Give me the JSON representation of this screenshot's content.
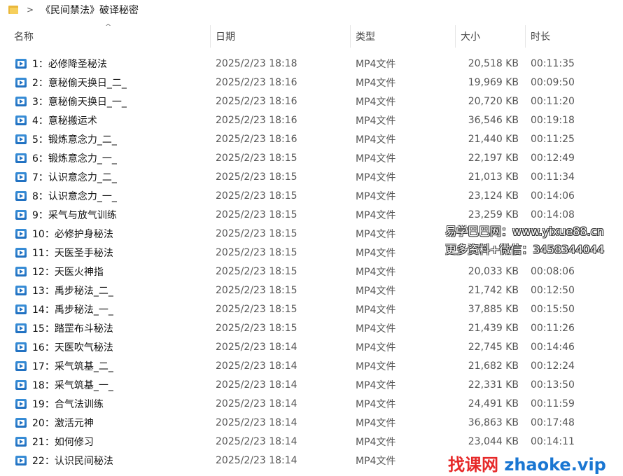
{
  "breadcrumb": {
    "separator": ">",
    "path": "《民间禁法》破译秘密"
  },
  "columns": {
    "name": "名称",
    "date": "日期",
    "type": "类型",
    "size": "大小",
    "duration": "时长",
    "sort_indicator": "^"
  },
  "files": [
    {
      "name": "1：必修降圣秘法",
      "date": "2025/2/23 18:18",
      "type": "MP4文件",
      "size": "20,518 KB",
      "duration": "00:11:35"
    },
    {
      "name": "2：意秘偷天换日_二_",
      "date": "2025/2/23 18:16",
      "type": "MP4文件",
      "size": "19,969 KB",
      "duration": "00:09:50"
    },
    {
      "name": "3：意秘偷天换日_一_",
      "date": "2025/2/23 18:16",
      "type": "MP4文件",
      "size": "20,720 KB",
      "duration": "00:11:20"
    },
    {
      "name": "4：意秘搬运术",
      "date": "2025/2/23 18:16",
      "type": "MP4文件",
      "size": "36,546 KB",
      "duration": "00:19:18"
    },
    {
      "name": "5：锻炼意念力_二_",
      "date": "2025/2/23 18:16",
      "type": "MP4文件",
      "size": "21,440 KB",
      "duration": "00:11:25"
    },
    {
      "name": "6：锻炼意念力_一_",
      "date": "2025/2/23 18:15",
      "type": "MP4文件",
      "size": "22,197 KB",
      "duration": "00:12:49"
    },
    {
      "name": "7：认识意念力_二_",
      "date": "2025/2/23 18:15",
      "type": "MP4文件",
      "size": "21,013 KB",
      "duration": "00:11:34"
    },
    {
      "name": "8：认识意念力_一_",
      "date": "2025/2/23 18:15",
      "type": "MP4文件",
      "size": "23,124 KB",
      "duration": "00:14:06"
    },
    {
      "name": "9：采气与放气训练",
      "date": "2025/2/23 18:15",
      "type": "MP4文件",
      "size": "23,259 KB",
      "duration": "00:14:08"
    },
    {
      "name": "10：必修护身秘法",
      "date": "2025/2/23 18:15",
      "type": "MP4文件",
      "size": "",
      "duration": ""
    },
    {
      "name": "11：天医圣手秘法",
      "date": "2025/2/23 18:15",
      "type": "MP4文件",
      "size": "",
      "duration": ""
    },
    {
      "name": "12：天医火神指",
      "date": "2025/2/23 18:15",
      "type": "MP4文件",
      "size": "20,033 KB",
      "duration": "00:08:06"
    },
    {
      "name": "13：禹步秘法_二_",
      "date": "2025/2/23 18:15",
      "type": "MP4文件",
      "size": "21,742 KB",
      "duration": "00:12:50"
    },
    {
      "name": "14：禹步秘法_一_",
      "date": "2025/2/23 18:15",
      "type": "MP4文件",
      "size": "37,885 KB",
      "duration": "00:15:50"
    },
    {
      "name": "15：踏罡布斗秘法",
      "date": "2025/2/23 18:15",
      "type": "MP4文件",
      "size": "21,439 KB",
      "duration": "00:11:26"
    },
    {
      "name": "16：天医吹气秘法",
      "date": "2025/2/23 18:14",
      "type": "MP4文件",
      "size": "22,745 KB",
      "duration": "00:14:46"
    },
    {
      "name": "17：采气筑基_二_",
      "date": "2025/2/23 18:14",
      "type": "MP4文件",
      "size": "21,682 KB",
      "duration": "00:12:24"
    },
    {
      "name": "18：采气筑基_一_",
      "date": "2025/2/23 18:14",
      "type": "MP4文件",
      "size": "22,331 KB",
      "duration": "00:13:50"
    },
    {
      "name": "19：合气法训练",
      "date": "2025/2/23 18:14",
      "type": "MP4文件",
      "size": "24,491 KB",
      "duration": "00:11:59"
    },
    {
      "name": "20：激活元神",
      "date": "2025/2/23 18:14",
      "type": "MP4文件",
      "size": "36,863 KB",
      "duration": "00:17:48"
    },
    {
      "name": "21：如何修习",
      "date": "2025/2/23 18:14",
      "type": "MP4文件",
      "size": "23,044 KB",
      "duration": "00:14:11"
    },
    {
      "name": "22：认识民间秘法",
      "date": "2025/2/23 18:14",
      "type": "MP4文件",
      "size": "",
      "duration": ""
    }
  ],
  "watermarks": {
    "line1": "易学巴巴网：www.yixue88.cn",
    "line2": "更多资料+微信：3458344044",
    "brand_cn": "找课网",
    "brand_en": "zhaoke.vip"
  },
  "colors": {
    "folder": "#f6cf5c",
    "video_icon": "#1f6fc0",
    "brand_red": "#e62828",
    "brand_blue": "#1976d2"
  }
}
